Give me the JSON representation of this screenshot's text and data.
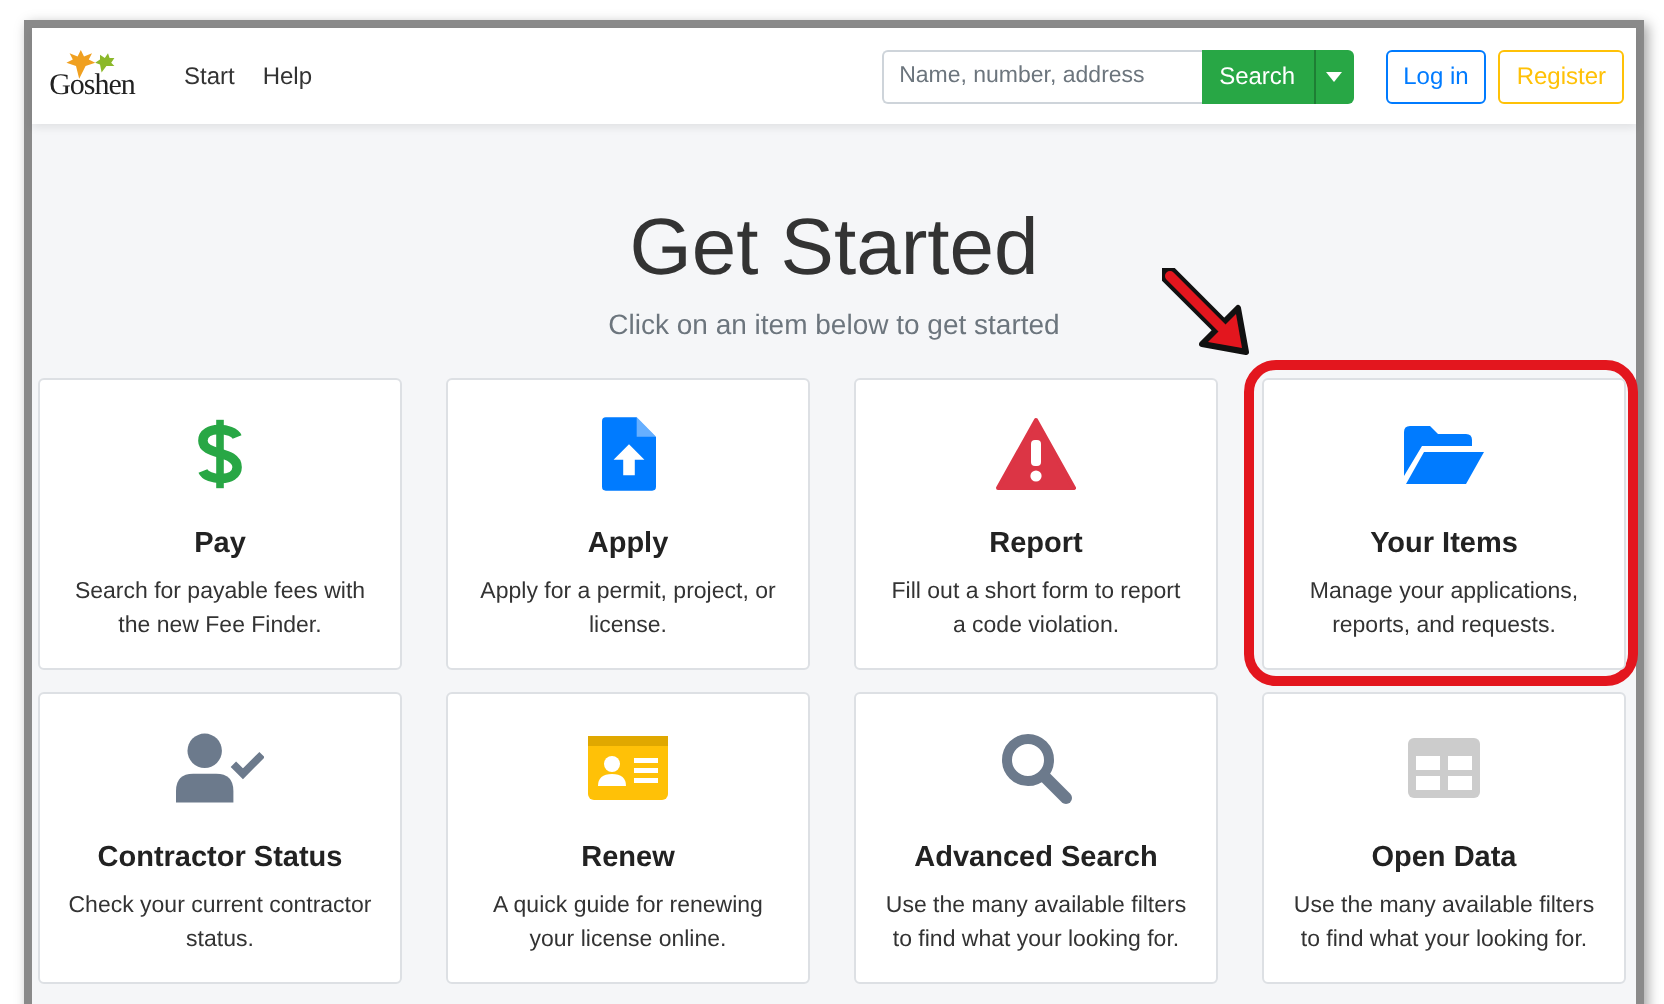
{
  "navbar": {
    "logo": "Goshen",
    "links": [
      "Start",
      "Help"
    ],
    "search": {
      "placeholder": "Name, number, address",
      "button": "Search"
    },
    "buttons": [
      {
        "label": "Log in",
        "kind": "primary"
      },
      {
        "label": "Register",
        "kind": "warning"
      }
    ]
  },
  "heading": "Get Started",
  "subheading": "Click on an item below to get started",
  "cards": [
    {
      "title": "Pay",
      "description": "Search for payable fees with the new Fee Finder.",
      "kind": "dollar",
      "color": "#28a745",
      "highlighted": false
    },
    {
      "title": "Apply",
      "description": "Apply for a permit, project, or license.",
      "kind": "upload",
      "color": "#007bff",
      "highlighted": false
    },
    {
      "title": "Report",
      "description": "Fill out a short form to report a code violation.",
      "kind": "warning",
      "color": "#dc3545",
      "highlighted": false
    },
    {
      "title": "Your Items",
      "description": "Manage your applications, reports, and requests.",
      "kind": "folder",
      "color": "#007bff",
      "highlighted": true
    },
    {
      "title": "Contractor Status",
      "description": "Check your current contractor status.",
      "kind": "user-check",
      "color": "#6c7a8c",
      "highlighted": false
    },
    {
      "title": "Renew",
      "description": "A quick guide for renewing your license online.",
      "kind": "id-card",
      "color": "#ffc107",
      "highlighted": false
    },
    {
      "title": "Advanced Search",
      "description": "Use the many available filters to find what your looking for.",
      "kind": "search",
      "color": "#6c7a8c",
      "highlighted": false
    },
    {
      "title": "Open Data",
      "description": "Use the many available filters to find what your looking for.",
      "kind": "table",
      "color": "#cccccc",
      "highlighted": false
    }
  ]
}
